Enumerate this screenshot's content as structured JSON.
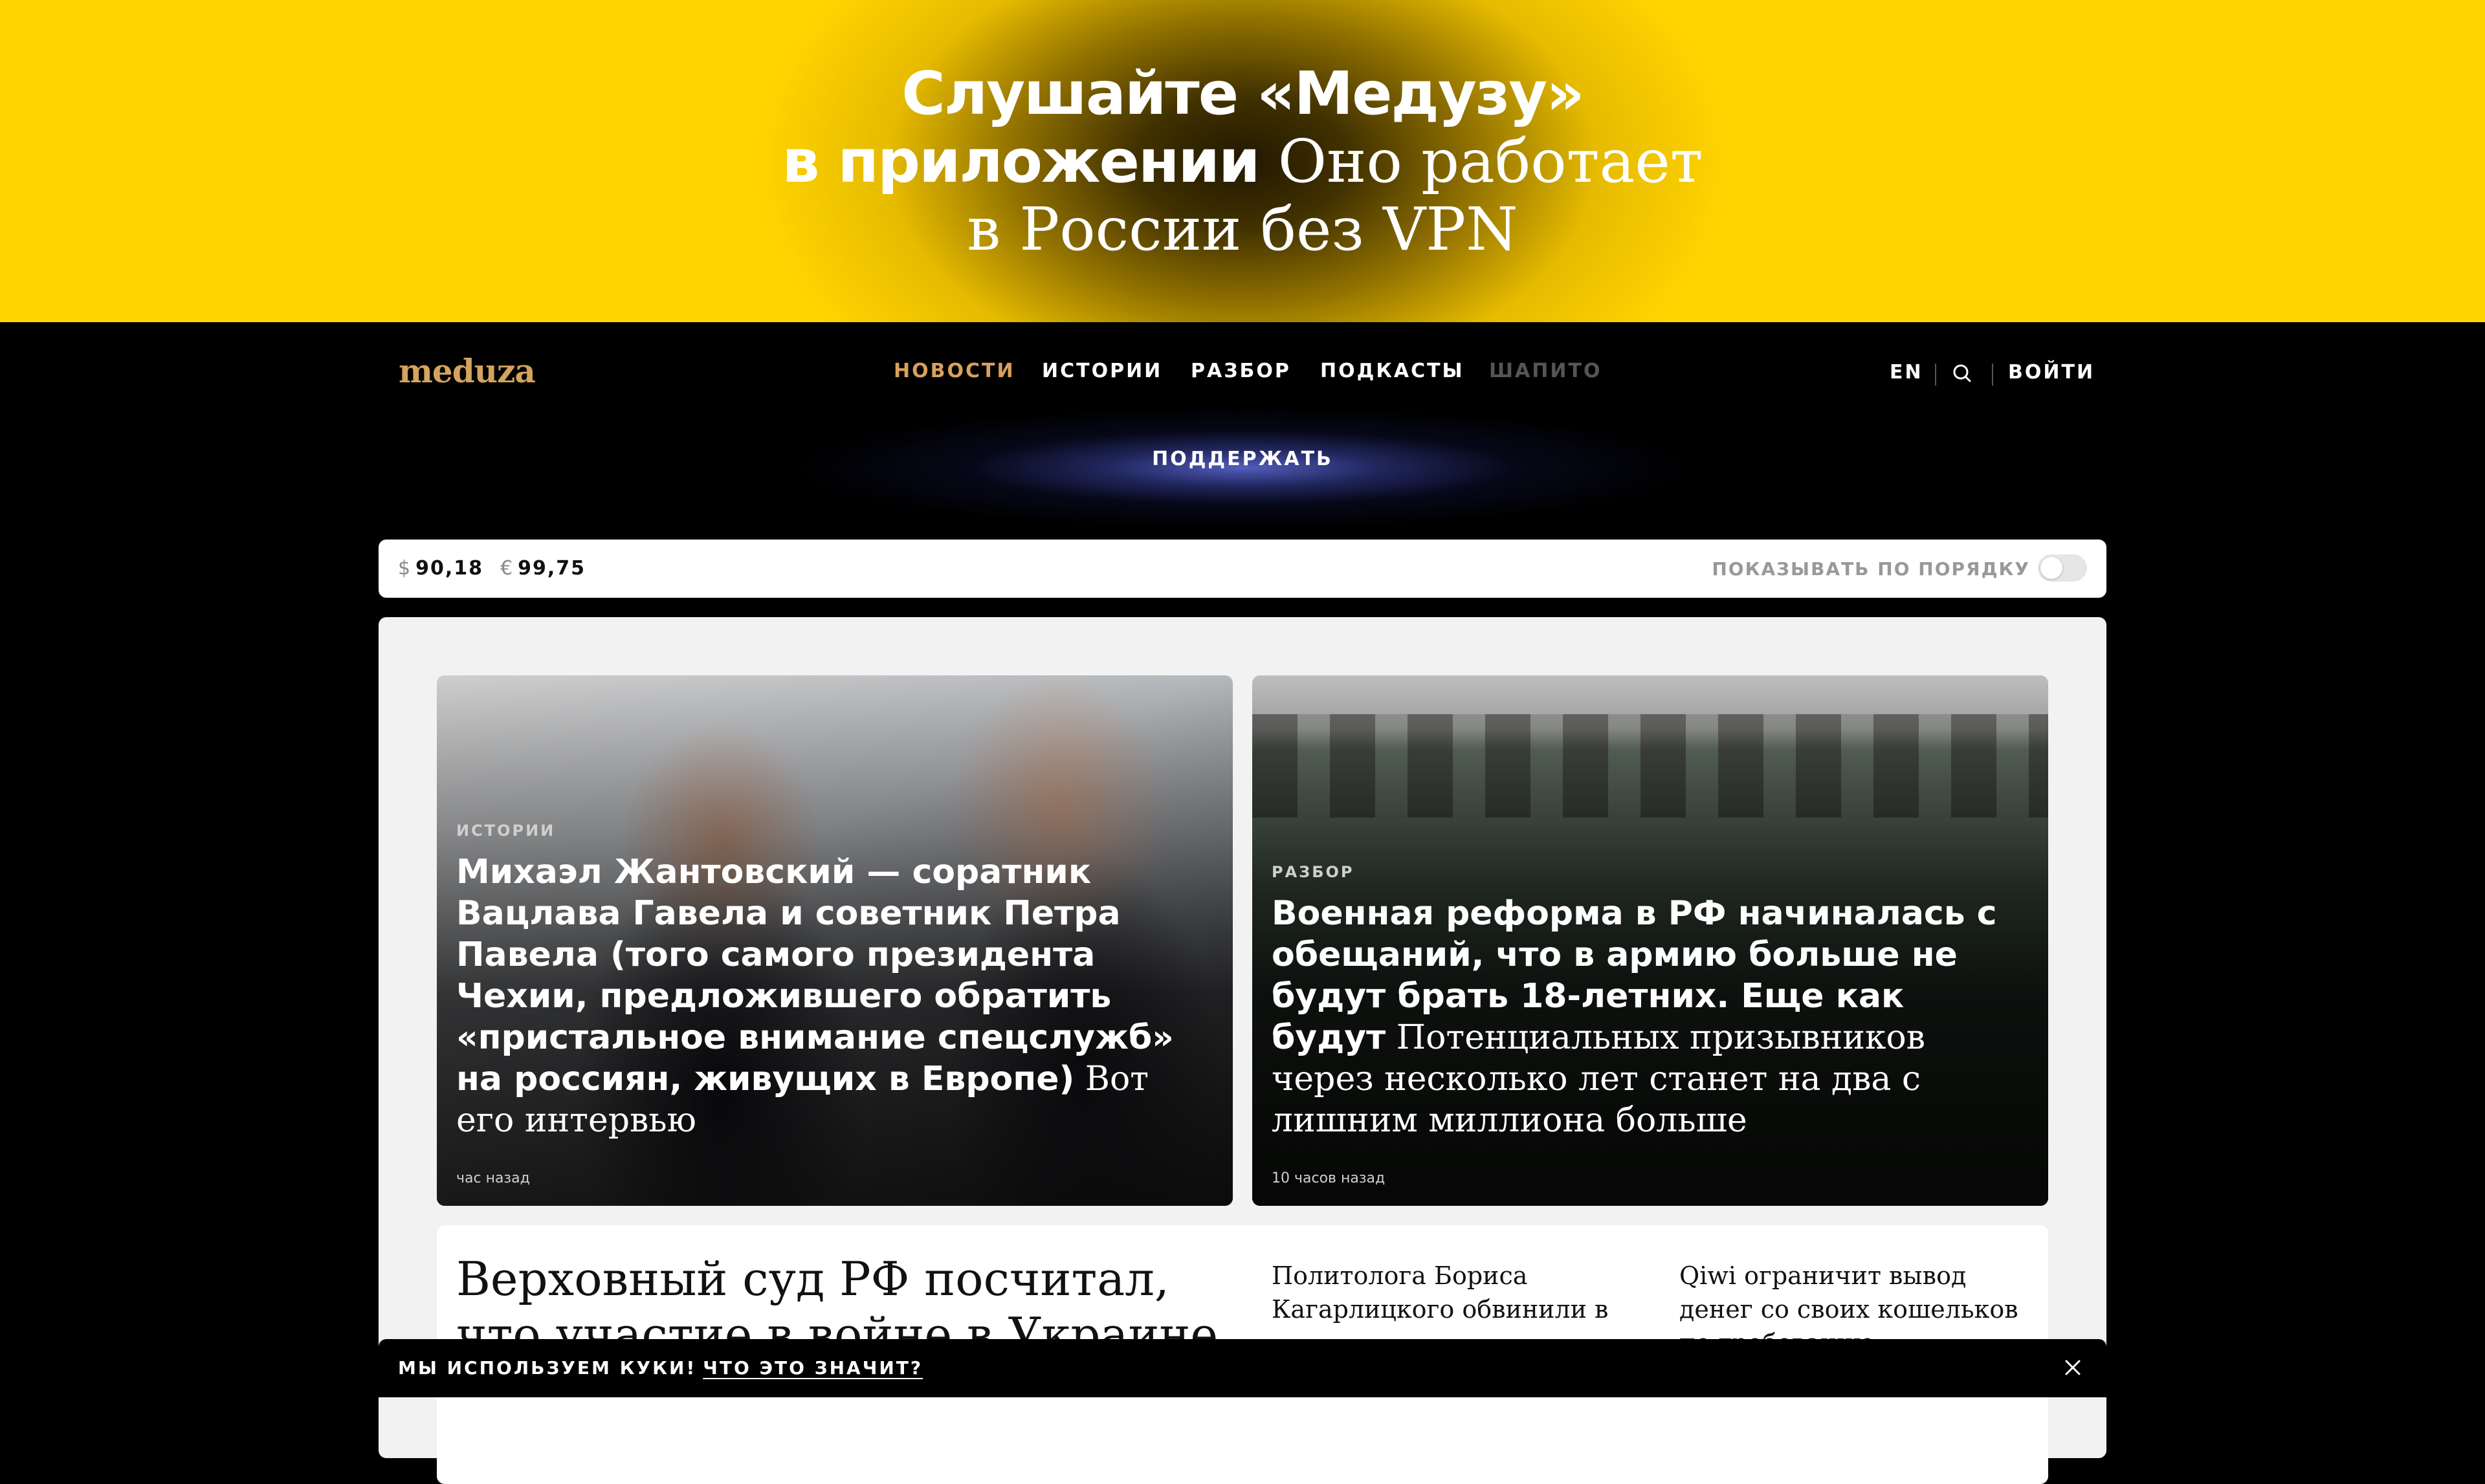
{
  "promo": {
    "line1_bold": "Слушайте «Медузу»",
    "line2_bold": "в приложении",
    "line2_serif": "Оно работает",
    "line3_serif": "в России без VPN"
  },
  "header": {
    "logo": "meduza",
    "nav": [
      {
        "label": "НОВОСТИ"
      },
      {
        "label": "ИСТОРИИ"
      },
      {
        "label": "РАЗБОР"
      },
      {
        "label": "ПОДКАСТЫ"
      },
      {
        "label": "ШАПИТО"
      }
    ],
    "lang": "EN",
    "login": "ВОЙТИ",
    "support": "ПОДДЕРЖАТЬ"
  },
  "infobar": {
    "usd_symbol": "$",
    "usd": "90,18",
    "eur_symbol": "€",
    "eur": "99,75",
    "order_label": "ПОКАЗЫВАТЬ ПО ПОРЯДКУ"
  },
  "cards": [
    {
      "tag": "ИСТОРИИ",
      "title": "Михаэл Жантовский — соратник Вацлава Гавела и советник Петра Павела (того самого президента Чехии, предложившего обратить «пристальное внимание спецслужб» на россиян, живущих в Европе)",
      "subtitle": "Вот его интервью",
      "time": "час назад"
    },
    {
      "tag": "РАЗБОР",
      "title": "Военная реформа в РФ начиналась с обещаний, что в армию больше не будут брать 18-летних. Еще как будут",
      "subtitle": "Потенциальных призывников через несколько лет станет на два с лишним миллиона больше",
      "time": "10 часов назад"
    }
  ],
  "lower": {
    "main_title": "Верховный суд РФ посчитал, что участие в войне в Украине",
    "col1": "Политолога Бориса Кагарлицкого обвинили в ...",
    "col2": "Qiwi ограничит вывод денег со своих кошельков по требованию ..."
  },
  "cookie": {
    "text": "МЫ ИСПОЛЬЗУЕМ КУКИ!",
    "link": "ЧТО ЭТО ЗНАЧИТ?"
  },
  "icons": {
    "search": "search-icon",
    "close": "close-icon"
  },
  "colors": {
    "promo_yellow": "#ffd500",
    "nav_active": "#d9a15c",
    "logo": "#d4a35c"
  }
}
